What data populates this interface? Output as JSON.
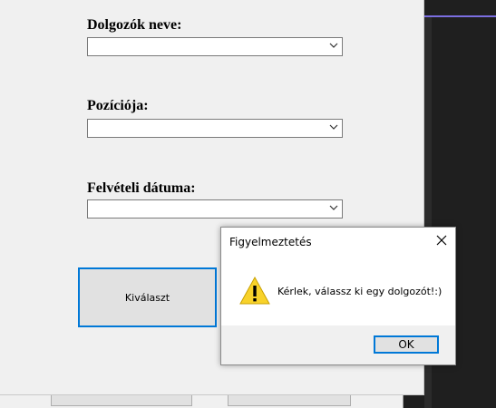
{
  "form": {
    "employee_name_label": "Dolgozók neve:",
    "position_label": "Pozíciója:",
    "hire_date_label": "Felvételi dátuma:",
    "select_button_label": "Kiválaszt",
    "employee_name_value": "",
    "position_value": "",
    "hire_date_value": ""
  },
  "dialog": {
    "title": "Figyelmeztetés",
    "message": "Kérlek, válassz ki egy dolgozót!:)",
    "ok_label": "OK",
    "icon": "warning-icon"
  },
  "colors": {
    "accent": "#0078d7",
    "form_background": "#f0f0f0",
    "warning_yellow": "#f8d22a",
    "dark_background": "#1f1f1f"
  }
}
